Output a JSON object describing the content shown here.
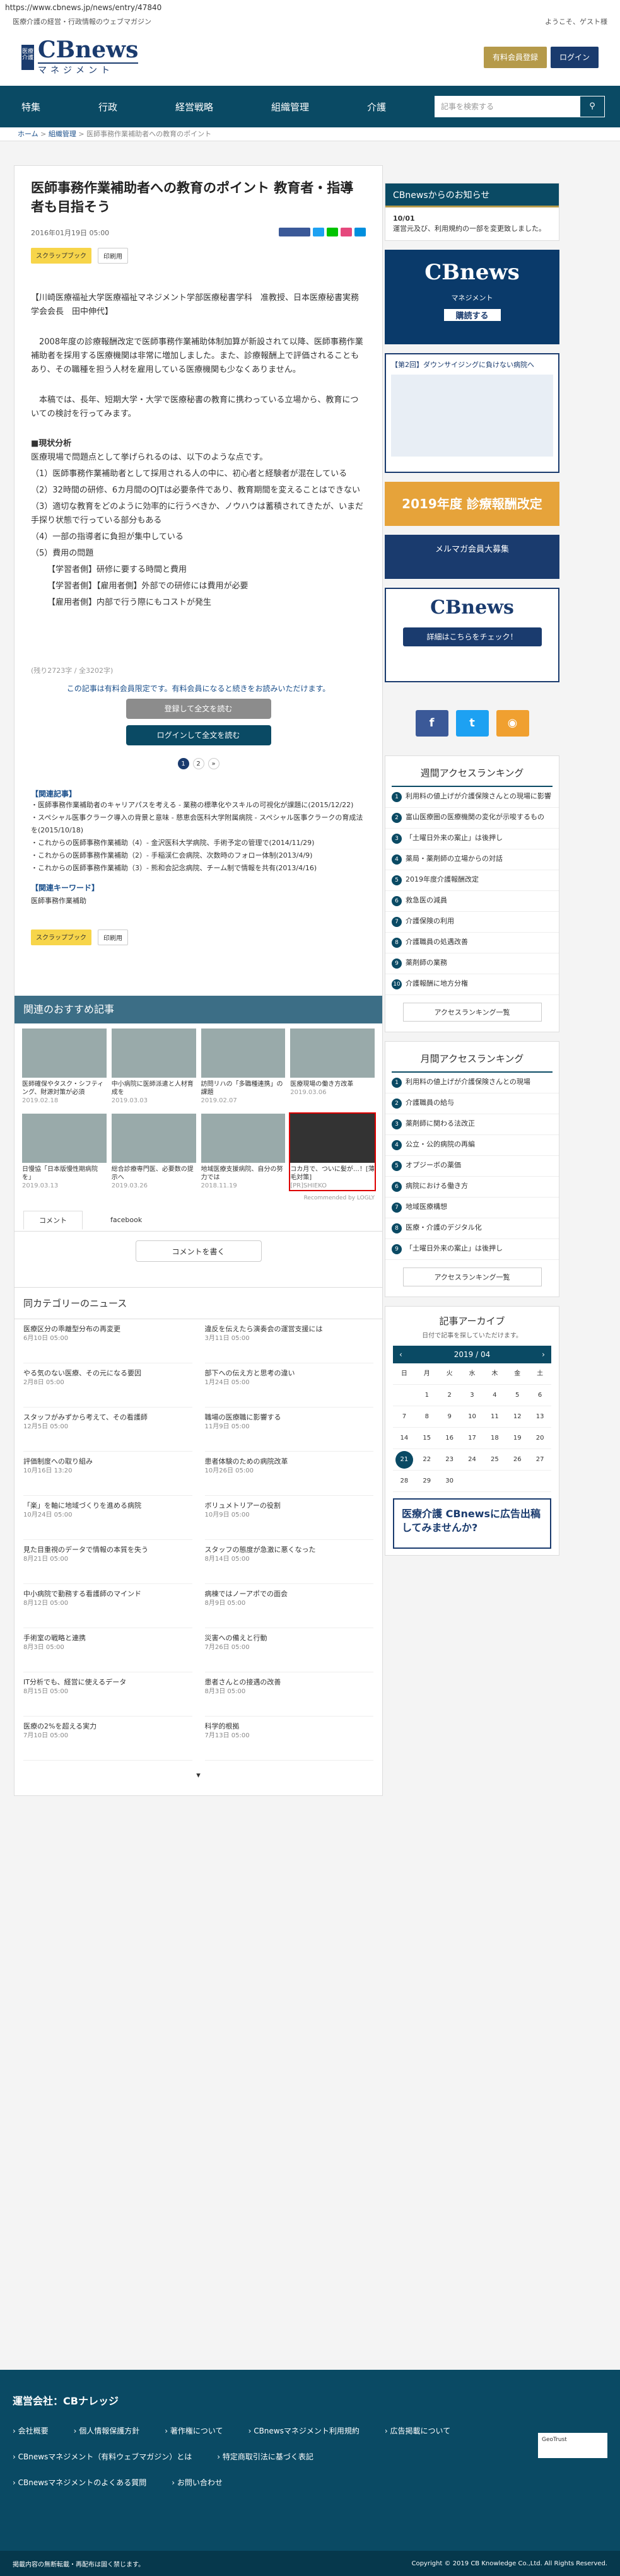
{
  "url": "https://www.cbnews.jp/news/entry/47840",
  "topline": {
    "left": "医療介護の経営・行政情報のウェブマガジン",
    "right": "ようこそ、ゲスト様"
  },
  "brand": {
    "mark": "医療介護",
    "name": "CBnews",
    "sub": "マネジメント"
  },
  "header": {
    "register": "有料会員登録",
    "login": "ログイン"
  },
  "nav": [
    "特集",
    "行政",
    "経営戦略",
    "組織管理",
    "介護"
  ],
  "search": {
    "placeholder": "記事を検索する"
  },
  "breadcrumb": {
    "home": "ホーム",
    "cat": "組織管理",
    "current": "医師事務作業補助者への教育のポイント"
  },
  "article": {
    "title": "医師事務作業補助者への教育のポイント 教育者・指導者も目指そう",
    "date": "2016年01月19日 05:00",
    "scrap": "スクラップブック",
    "print": "印刷用",
    "author": "【川崎医療福祉大学医療福祉マネジメント学部医療秘書学科　准教授、日本医療秘書実務学会会長　田中伸代】",
    "p1": "2008年度の診療報酬改定で医師事務作業補助体制加算が新設されて以降、医師事務作業補助者を採用する医療機関は非常に増加しました。また、診療報酬上で評価されることもあり、その職種を担う人材を雇用している医療機関も少なくありません。",
    "p2": "本稿では、長年、短期大学・大学で医療秘書の教育に携わっている立場から、教育についての検討を行ってみます。",
    "sec": "■現状分析",
    "lead": "医療現場で問題点として挙げられるのは、以下のような点です。",
    "points": [
      "（1）医師事務作業補助者として採用される人の中に、初心者と経験者が混在している",
      "（2）32時間の研修、6カ月間のOJTは必要条件であり、教育期間を変えることはできない",
      "（3）適切な教育をどのように効率的に行うべきか、ノウハウは蓄積されてきたが、いまだ手探り状態で行っている部分もある",
      "（4）一部の指導者に負担が集中している",
      "（5）費用の問題",
      "【学習者側】研修に要する時間と費用",
      "【学習者側】【雇用者側】外部での研修には費用が必要",
      "【雇用者側】内部で行う際にもコストが発生"
    ],
    "wordcount": "(残り2723字 / 全3202字)",
    "member": "この記事は有料会員限定です。有料会員になると続きをお読みいただけます。",
    "reg_btn": "登録して全文を読む",
    "login_btn": "ログインして全文を読む",
    "pages": [
      "1",
      "2",
      "»"
    ],
    "related_title": "【関連記事】",
    "related": [
      "医師事務作業補助者のキャリアパスを考える - 業務の標準化やスキルの可視化が課題に(2015/12/22)",
      "スペシャル医事クラーク導入の背景と意味 - 慈恵会医科大学附属病院 - スペシャル医事クラークの育成法を(2015/10/18)",
      "これからの医師事務作業補助（4）- 金沢医科大学病院、手術予定の管理で(2014/11/29)",
      "これからの医師事務作業補助（2）- 手稲渓仁会病院、次数時のフォロー体制(2013/4/9)",
      "これからの医師事務作業補助（3）- 熊和会記念病院、チーム制で情報を共有(2013/4/16)"
    ],
    "keyword_title": "【関連キーワード】",
    "keyword": "医師事務作業補助"
  },
  "recommend": {
    "title": "関連のおすすめ記事",
    "items": [
      {
        "t": "医師確保やタスク・シフティング、財源対策が必須",
        "d": "2019.02.18"
      },
      {
        "t": "中小病院に医師派遣と人材育成を",
        "d": "2019.03.03"
      },
      {
        "t": "訪問リハの「多職種連携」の課題",
        "d": "2019.02.07"
      },
      {
        "t": "医療現場の働き方改革",
        "d": "2019.03.06"
      },
      {
        "t": "日慢協「日本版慢性期病院を」",
        "d": "2019.03.13"
      },
      {
        "t": "総合診療専門医、必要数の提示へ",
        "d": "2019.03.26"
      },
      {
        "t": "地域医療支援病院、自分の努力では",
        "d": "2018.11.19"
      },
      {
        "t": "コカ月で、ついに髪が…！[薄毛対策]",
        "d": "[PR]SHIEKO"
      }
    ],
    "credit": "Recommended by LOGLY"
  },
  "comments": {
    "tab1": "コメント",
    "tab2": "facebook",
    "write": "コメントを書く"
  },
  "category": {
    "title": "同カテゴリーのニュース",
    "items": [
      {
        "t": "医療区分の乖離型分布の再変更",
        "d": "6月10日 05:00"
      },
      {
        "t": "違反を伝えたら演奏会の運営支援には",
        "d": "3月11日 05:00"
      },
      {
        "t": "やる気のない医療、その元になる要因",
        "d": "2月8日 05:00"
      },
      {
        "t": "部下への伝え方と思考の違い",
        "d": "1月24日 05:00"
      },
      {
        "t": "スタッフがみずから考えて、その看護師",
        "d": "12月5日 05:00"
      },
      {
        "t": "職場の医療職に影響する",
        "d": "11月9日 05:00"
      },
      {
        "t": "評価制度への取り組み",
        "d": "10月16日 13:20"
      },
      {
        "t": "患者体験のための病院改革",
        "d": "10月26日 05:00"
      },
      {
        "t": "「楽」を軸に地域づくりを進める病院",
        "d": "10月24日 05:00"
      },
      {
        "t": "ボリュメトリアーの役割",
        "d": "10月9日 05:00"
      },
      {
        "t": "見た目重視のデータで情報の本質を失う",
        "d": "8月21日 05:00"
      },
      {
        "t": "スタッフの態度が急激に悪くなった",
        "d": "8月14日 05:00"
      },
      {
        "t": "中小病院で勤務する看護師のマインド",
        "d": "8月12日 05:00"
      },
      {
        "t": "病棟ではノーアポでの面会",
        "d": "8月9日 05:00"
      },
      {
        "t": "手術室の戦略と連携",
        "d": "8月3日 05:00"
      },
      {
        "t": "災害への備えと行動",
        "d": "7月26日 05:00"
      },
      {
        "t": "IT分析でも、経営に使えるデータ",
        "d": "8月15日 05:00"
      },
      {
        "t": "患者さんとの接遇の改善",
        "d": "8月3日 05:00"
      },
      {
        "t": "医療の2%を超える実力",
        "d": "7月10日 05:00"
      },
      {
        "t": "科学的根拠",
        "d": "7月13日 05:00"
      }
    ]
  },
  "sidebar": {
    "notice_title": "CBnewsからのお知らせ",
    "notice_date": "10/01",
    "notice_text": "運営元及び、利用規約の一部を変更致しました。",
    "ad1": "CBnews",
    "ad1s": "マネジメント",
    "ad1c": "購読する",
    "ad_seminar": "【第2回】ダウンサイジングに負けない病院へ",
    "ad_yellow": "2019年度 診療報酬改定",
    "ad_blue": "メルマガ会員大募集",
    "ad_white": "CBnews",
    "ad_white_btn": "詳細はこちらをチェック！",
    "rank1_title": "週間アクセスランキング",
    "rank1": [
      "利用料の値上げが介護保険さんとの現場に影響",
      "富山医療圏の医療機関の変化が示唆するもの",
      "「土曜日外来の案止」は後押し",
      "薬局・薬剤師の立場からの対話",
      "2019年度介護報酬改定",
      "救急医の減員",
      "介護保険の利用",
      "介護職員の処遇改善",
      "薬剤師の業務",
      "介護報酬に地方分権"
    ],
    "rank_more": "アクセスランキング一覧",
    "rank2_title": "月間アクセスランキング",
    "rank2": [
      "利用料の値上げが介護保険さんとの現場",
      "介護職員の給与",
      "薬剤師に関わる法改正",
      "公立・公的病院の再編",
      "オプジーボの薬価",
      "病院における働き方",
      "地域医療構想",
      "医療・介護のデジタル化",
      "「土曜日外来の案止」は後押し"
    ],
    "calendar_title": "記事アーカイブ",
    "calendar_sub": "日付で記事を探していただけます。",
    "calendar_month": "2019 / 04",
    "calendar_days": [
      "日",
      "月",
      "火",
      "水",
      "木",
      "金",
      "土",
      "",
      "1",
      "2",
      "3",
      "4",
      "5",
      "6",
      "7",
      "8",
      "9",
      "10",
      "11",
      "12",
      "13",
      "14",
      "15",
      "16",
      "17",
      "18",
      "19",
      "20",
      "21",
      "22",
      "23",
      "24",
      "25",
      "26",
      "27",
      "28",
      "29",
      "30",
      "",
      "",
      "",
      ""
    ],
    "ad_bottom": "医療介護 CBnewsに広告出稿してみませんか?"
  },
  "footer": {
    "title": "運営会社：CBナレッジ",
    "links": [
      "会社概要",
      "個人情報保護方針",
      "著作権について",
      "CBnewsマネジメント利用規約",
      "広告掲載について",
      "CBnewsマネジメント（有料ウェブマガジン）とは",
      "特定商取引法に基づく表記",
      "CBnewsマネジメントのよくある質問",
      "お問い合わせ"
    ],
    "left": "掲載内容の無断転載・再配布は固く禁じます。",
    "right": "Copyright © 2019 CB Knowledge Co.,Ltd. All Rights Reserved."
  }
}
